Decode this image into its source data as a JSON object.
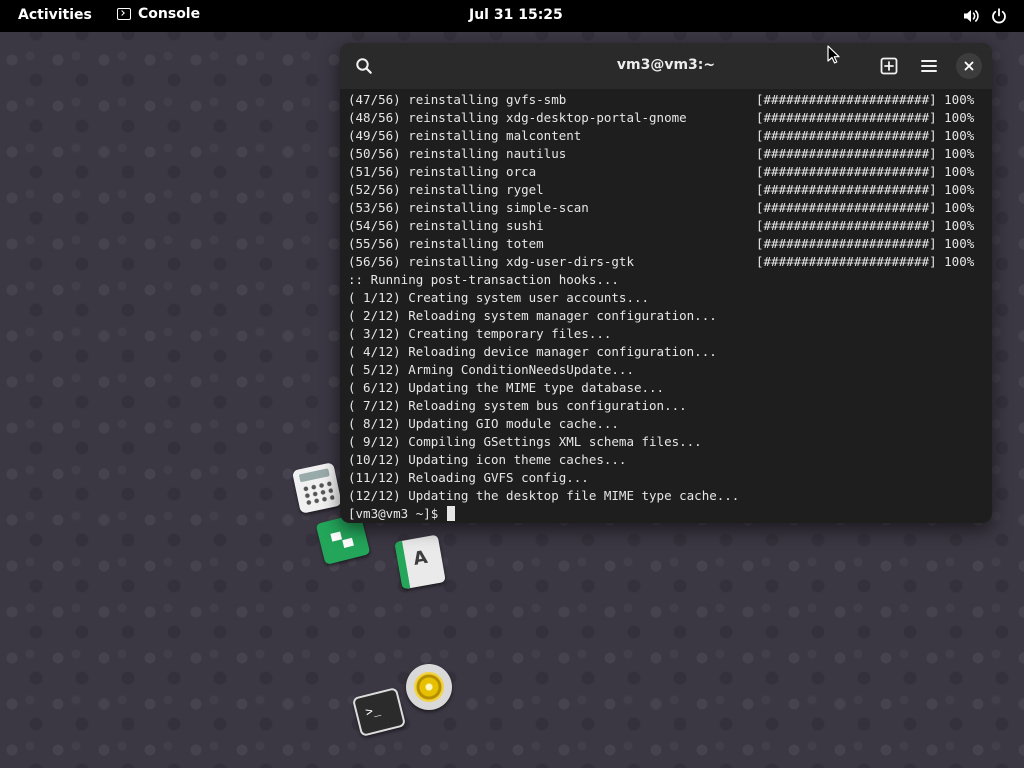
{
  "topbar": {
    "activities": "Activities",
    "app_name": "Console",
    "clock": "Jul 31  15:25"
  },
  "window": {
    "title": "vm3@vm3:~"
  },
  "terminal": {
    "lines": [
      "(47/56) reinstalling gvfs-smb",
      "(48/56) reinstalling xdg-desktop-portal-gnome",
      "(49/56) reinstalling malcontent",
      "(50/56) reinstalling nautilus",
      "(51/56) reinstalling orca",
      "(52/56) reinstalling rygel",
      "(53/56) reinstalling simple-scan",
      "(54/56) reinstalling sushi",
      "(55/56) reinstalling totem",
      "(56/56) reinstalling xdg-user-dirs-gtk",
      ":: Running post-transaction hooks...",
      "( 1/12) Creating system user accounts...",
      "( 2/12) Reloading system manager configuration...",
      "( 3/12) Creating temporary files...",
      "( 4/12) Reloading device manager configuration...",
      "( 5/12) Arming ConditionNeedsUpdate...",
      "( 6/12) Updating the MIME type database...",
      "( 7/12) Reloading system bus configuration...",
      "( 8/12) Updating GIO module cache...",
      "( 9/12) Compiling GSettings XML schema files...",
      "(10/12) Updating icon theme caches...",
      "(11/12) Reloading GVFS config...",
      "(12/12) Updating the desktop file MIME type cache..."
    ],
    "progress": "[######################] 100%",
    "progress_line_count": 10,
    "prompt": "[vm3@vm3 ~]$ "
  },
  "desktop_icons": {
    "writer_glyph": "A",
    "terminal_glyph": ">_"
  }
}
